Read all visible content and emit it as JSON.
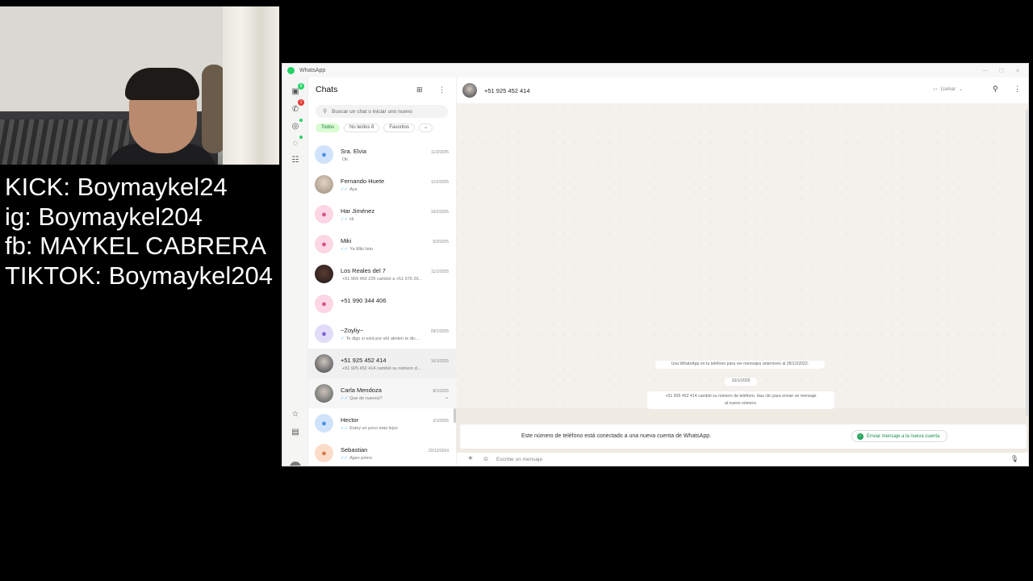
{
  "stream_overlay": {
    "lines": [
      "KICK: Boymaykel24",
      "ig: Boymaykel204",
      "fb: MAYKEL CABRERA",
      "TIKTOK: Boymaykel204"
    ]
  },
  "window": {
    "title": "WhatsApp"
  },
  "rail": {
    "chats_badge": "8",
    "calls_badge": "1"
  },
  "chat_list": {
    "title": "Chats",
    "search_placeholder": "Buscar un chat o iniciar uno nuevo",
    "filters": [
      "Todos",
      "No leídos 8",
      "Favoritos",
      "⌄"
    ],
    "items": [
      {
        "name": "Sra. Elvia",
        "time": "11/2/2025",
        "preview": "Ok",
        "ticks": ""
      },
      {
        "name": "Fernando Huete",
        "time": "11/2/2025",
        "preview": "Aya",
        "ticks": "✓✓"
      },
      {
        "name": "Har Jiménez",
        "time": "10/2/2025",
        "preview": "Hi",
        "ticks": "✓✓"
      },
      {
        "name": "Miki",
        "time": "6/2/2025",
        "preview": "Ya Miki listo",
        "ticks": "✓✓"
      },
      {
        "name": "Los Reales del 7",
        "time": "11/1/2025",
        "preview": "+51 969 460 225 cambió a +51 976 29...",
        "ticks": ""
      },
      {
        "name": "+51 990 344 406",
        "time": "",
        "preview": "",
        "ticks": ""
      },
      {
        "name": "~Zoyliy~",
        "time": "29/1/2025",
        "preview": "Te digo si está por ahí alinten te dic...",
        "ticks": "✓"
      },
      {
        "name": "+51 925 452 414",
        "time": "10/1/2025",
        "preview": "+51 925 452 414 cambió su número d...",
        "ticks": ""
      },
      {
        "name": "Carla Mendoza",
        "time": "8/1/2025",
        "preview": "Que de nuevos?",
        "ticks": "✓✓"
      },
      {
        "name": "Hector",
        "time": "2/1/2025",
        "preview": "Estoy un poco más lejos",
        "ticks": "✓✓"
      },
      {
        "name": "Sebastian",
        "time": "22/12/2024",
        "preview": "Ajam primo",
        "ticks": "✓✓"
      }
    ]
  },
  "conversation": {
    "contact": "+51 925 452 414",
    "call_label": "Llamar",
    "system_old_msgs": "Usa WhatsApp en tu teléfono para ver mensajes anteriores al 28/12/2022.",
    "date_chip": "10/1/2025",
    "system_number_change_1": "+51 925 452 414 cambió su número de teléfono. Haz clic para enviar un mensaje",
    "system_number_change_2": "al nuevo número.",
    "notice_text": "Este número de teléfono está conectado a una nueva cuenta de WhatsApp.",
    "notice_button": "Enviar mensaje a la nueva cuenta",
    "composer_placeholder": "Escribe un mensaje"
  },
  "colors": {
    "accent_green": "#25d366",
    "chip_active_bg": "#d9fdd3",
    "read_ticks": "#53bdeb"
  }
}
